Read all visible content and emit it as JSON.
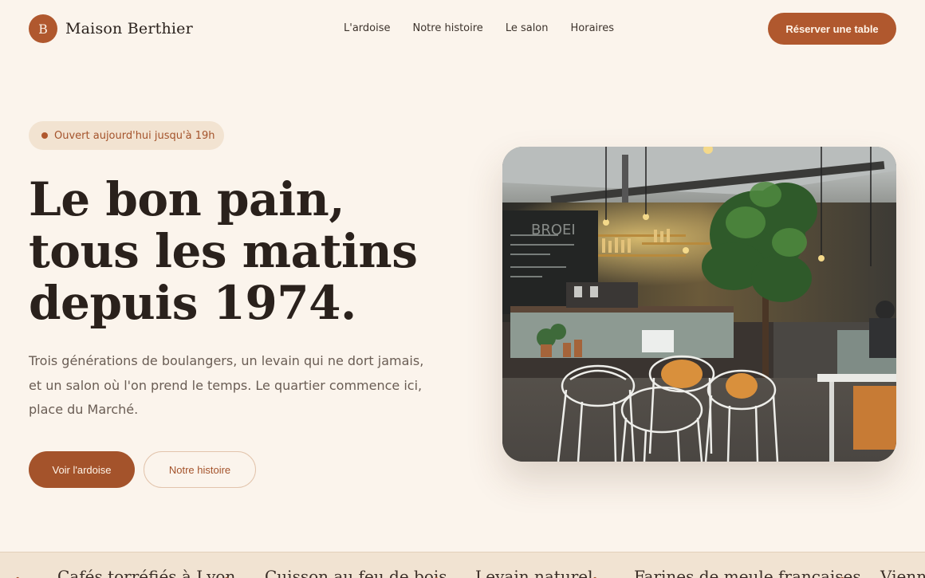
{
  "brand": {
    "initial": "B",
    "name": "Maison Berthier"
  },
  "nav": {
    "links": [
      "L'ardoise",
      "Notre histoire",
      "Le salon",
      "Horaires"
    ],
    "cta": "Réserver une table"
  },
  "hero": {
    "status": "Ouvert aujourd'hui jusqu'à 19h",
    "title_lines": [
      "Le bon pain,",
      "tous les matins",
      "depuis 1974."
    ],
    "text_lines": [
      "Trois générations de boulangers, un levain qui ne dort jamais,",
      "et un salon où l'on prend le temps. Le quartier commence ici,",
      "place du Marché."
    ],
    "primary_button": "Voir l'ardoise",
    "secondary_button": "Notre histoire"
  },
  "band": {
    "items": [
      "Cafés torréfiés à Lyon",
      "Cuisson au feu de bois",
      "Levain naturel",
      "Farines de meule françaises",
      "Viennoiseries"
    ],
    "separator": "•"
  },
  "photo": {
    "sign_text": "BROEI"
  },
  "colors": {
    "accent": "#b0582e",
    "background": "#fbf4ec",
    "pill": "#f2e3d1",
    "ink": "#2a211c"
  }
}
